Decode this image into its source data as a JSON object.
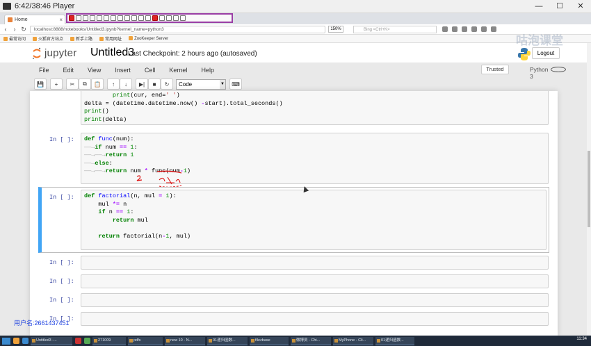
{
  "player": {
    "title": "6:42/38:46 Player",
    "minimize": "—",
    "maximize": "☐",
    "close": "✕"
  },
  "browser": {
    "tab_title": "Home",
    "tab_close": "×",
    "url": "localhost:8888/notebooks/Untitled3.ipynb?kernel_name=python3",
    "zoom": "150%",
    "search_placeholder": "Bing <Ctrl+K>",
    "back": "‹",
    "forward": "›",
    "reload": "↻",
    "bookmarks": [
      "最常访问",
      "火狐官方站点",
      "新手上路",
      "常用网址",
      "ZooKeeper Server"
    ]
  },
  "watermark": "咕泡课堂",
  "jupyter": {
    "logo_text": "jupyter",
    "notebook_name": "Untitled3",
    "checkpoint": "Last Checkpoint: 2 hours ago (autosaved)",
    "logout_label": "Logout",
    "menu": [
      "File",
      "Edit",
      "View",
      "Insert",
      "Cell",
      "Kernel",
      "Help"
    ],
    "trusted_label": "Trusted",
    "kernel_name": "Python 3",
    "cell_type": "Code",
    "toolbar_icons": [
      "save-icon",
      "add-cell-icon",
      "cut-icon",
      "copy-icon",
      "paste-icon",
      "move-up-icon",
      "move-down-icon",
      "run-icon",
      "stop-icon",
      "restart-icon",
      "keyboard-icon"
    ]
  },
  "cells": [
    {
      "prompt": "",
      "lines": [
        "        print(cur, end=' ')",
        "delta = (datetime.datetime.now() -start).total_seconds()",
        "print()",
        "print(delta)"
      ]
    },
    {
      "prompt": "In  [  ]:",
      "lines": [
        "def func(num):",
        "——→if num == 1:",
        "——→——→return 1",
        "——→else:",
        "——→——→return num * func(num-1)"
      ]
    },
    {
      "prompt": "In  [  ]:",
      "lines": [
        "def factorial(n, mul = 1):",
        "    mul *= n",
        "    if n == 1:",
        "        return mul",
        "",
        "    return factorial(n-1, mul)"
      ]
    },
    {
      "prompt": "In  [  ]:",
      "lines": [
        ""
      ]
    },
    {
      "prompt": "In  [  ]:",
      "lines": [
        ""
      ]
    },
    {
      "prompt": "In  [  ]:",
      "lines": [
        ""
      ]
    },
    {
      "prompt": "In  [  ]:",
      "lines": [
        ""
      ]
    }
  ],
  "overlay_user": "用户名:2661437451",
  "taskbar": {
    "items": [
      "Untitled3 -...",
      "271009",
      "pdfs",
      "new 10 - N...",
      "01递归函数...",
      "filezbase",
      "微博员 - Chi...",
      "MyPhone - Cli...",
      "01递归函数..."
    ],
    "clock": "11:34"
  },
  "colors": {
    "prompt": "#303f9f",
    "selected_border": "#42a5f5",
    "annotation": "#d11"
  }
}
